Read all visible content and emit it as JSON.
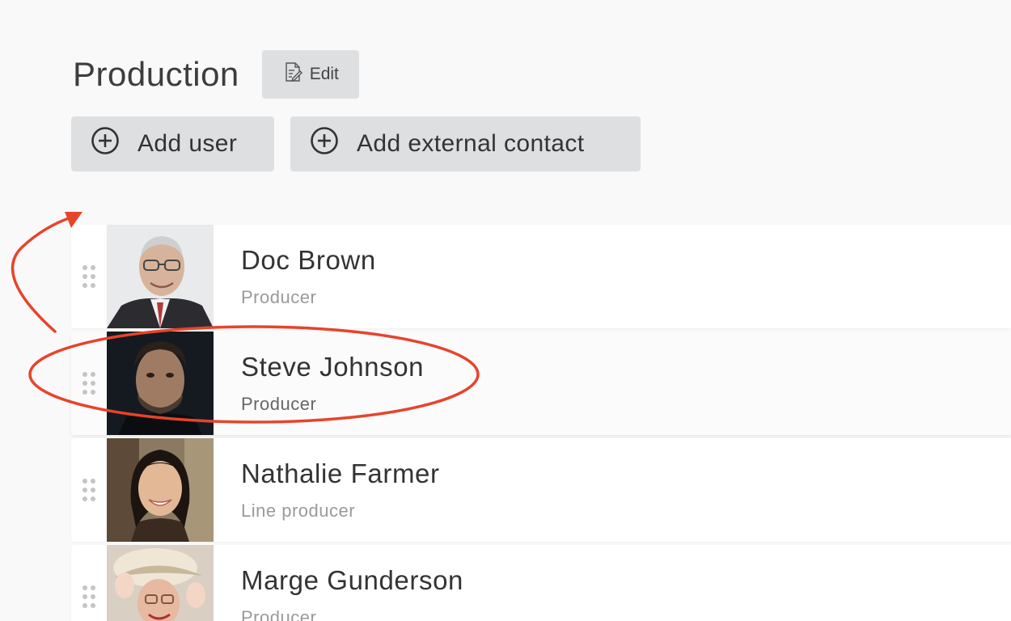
{
  "section": {
    "title": "Production",
    "edit_label": "Edit"
  },
  "actions": {
    "add_user_label": "Add user",
    "add_external_contact_label": "Add external contact"
  },
  "members": [
    {
      "name": "Doc Brown",
      "role": "Producer",
      "selected": false
    },
    {
      "name": "Steve Johnson",
      "role": "Producer",
      "selected": true
    },
    {
      "name": "Nathalie Farmer",
      "role": "Line producer",
      "selected": false
    },
    {
      "name": "Marge Gunderson",
      "role": "Producer",
      "selected": false
    }
  ],
  "icons": {
    "edit": "edit-document-icon",
    "add": "plus-circle-icon",
    "drag": "drag-handle-icon"
  },
  "colors": {
    "annotation": "#e8432b",
    "button_bg": "#dedfe1",
    "page_bg": "#f9f9f9"
  }
}
